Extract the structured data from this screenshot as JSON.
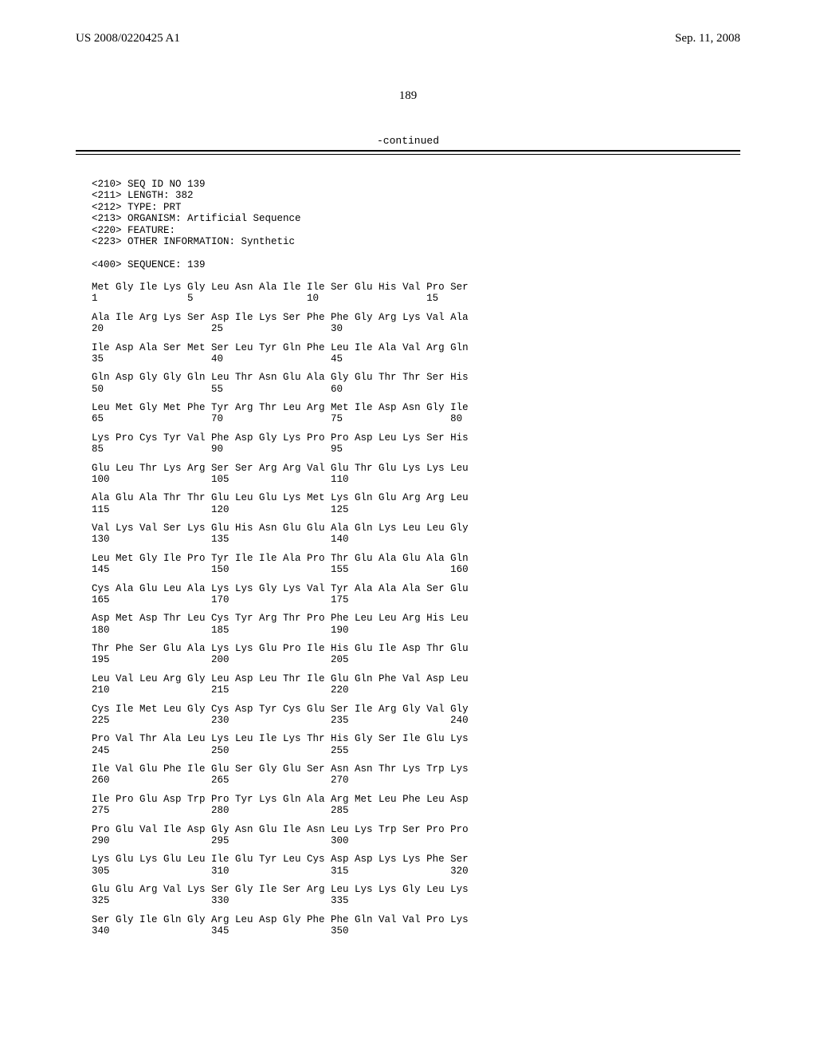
{
  "header": {
    "pub_number": "US 2008/0220425 A1",
    "pub_date": "Sep. 11, 2008"
  },
  "page_number": "189",
  "continued_label": "-continued",
  "meta_lines": [
    "<210> SEQ ID NO 139",
    "<211> LENGTH: 382",
    "<212> TYPE: PRT",
    "<213> ORGANISM: Artificial Sequence",
    "<220> FEATURE:",
    "<223> OTHER INFORMATION: Synthetic",
    "",
    "<400> SEQUENCE: 139"
  ],
  "sequence_rows": [
    {
      "aa": "Met Gly Ile Lys Gly Leu Asn Ala Ile Ile Ser Glu His Val Pro Ser",
      "nums": [
        "1",
        "5",
        "10",
        "15"
      ],
      "pos": [
        0,
        4,
        9,
        14
      ]
    },
    {
      "aa": "Ala Ile Arg Lys Ser Asp Ile Lys Ser Phe Phe Gly Arg Lys Val Ala",
      "nums": [
        "20",
        "25",
        "30"
      ],
      "pos": [
        0,
        5,
        10
      ]
    },
    {
      "aa": "Ile Asp Ala Ser Met Ser Leu Tyr Gln Phe Leu Ile Ala Val Arg Gln",
      "nums": [
        "35",
        "40",
        "45"
      ],
      "pos": [
        0,
        5,
        10
      ]
    },
    {
      "aa": "Gln Asp Gly Gly Gln Leu Thr Asn Glu Ala Gly Glu Thr Thr Ser His",
      "nums": [
        "50",
        "55",
        "60"
      ],
      "pos": [
        0,
        5,
        10
      ]
    },
    {
      "aa": "Leu Met Gly Met Phe Tyr Arg Thr Leu Arg Met Ile Asp Asn Gly Ile",
      "nums": [
        "65",
        "70",
        "75",
        "80"
      ],
      "pos": [
        0,
        5,
        10,
        15
      ]
    },
    {
      "aa": "Lys Pro Cys Tyr Val Phe Asp Gly Lys Pro Pro Asp Leu Lys Ser His",
      "nums": [
        "85",
        "90",
        "95"
      ],
      "pos": [
        0,
        5,
        10
      ]
    },
    {
      "aa": "Glu Leu Thr Lys Arg Ser Ser Arg Arg Val Glu Thr Glu Lys Lys Leu",
      "nums": [
        "100",
        "105",
        "110"
      ],
      "pos": [
        0,
        5,
        10
      ]
    },
    {
      "aa": "Ala Glu Ala Thr Thr Glu Leu Glu Lys Met Lys Gln Glu Arg Arg Leu",
      "nums": [
        "115",
        "120",
        "125"
      ],
      "pos": [
        0,
        5,
        10
      ]
    },
    {
      "aa": "Val Lys Val Ser Lys Glu His Asn Glu Glu Ala Gln Lys Leu Leu Gly",
      "nums": [
        "130",
        "135",
        "140"
      ],
      "pos": [
        0,
        5,
        10
      ]
    },
    {
      "aa": "Leu Met Gly Ile Pro Tyr Ile Ile Ala Pro Thr Glu Ala Glu Ala Gln",
      "nums": [
        "145",
        "150",
        "155",
        "160"
      ],
      "pos": [
        0,
        5,
        10,
        15
      ]
    },
    {
      "aa": "Cys Ala Glu Leu Ala Lys Lys Gly Lys Val Tyr Ala Ala Ala Ser Glu",
      "nums": [
        "165",
        "170",
        "175"
      ],
      "pos": [
        0,
        5,
        10
      ]
    },
    {
      "aa": "Asp Met Asp Thr Leu Cys Tyr Arg Thr Pro Phe Leu Leu Arg His Leu",
      "nums": [
        "180",
        "185",
        "190"
      ],
      "pos": [
        0,
        5,
        10
      ]
    },
    {
      "aa": "Thr Phe Ser Glu Ala Lys Lys Glu Pro Ile His Glu Ile Asp Thr Glu",
      "nums": [
        "195",
        "200",
        "205"
      ],
      "pos": [
        0,
        5,
        10
      ]
    },
    {
      "aa": "Leu Val Leu Arg Gly Leu Asp Leu Thr Ile Glu Gln Phe Val Asp Leu",
      "nums": [
        "210",
        "215",
        "220"
      ],
      "pos": [
        0,
        5,
        10
      ]
    },
    {
      "aa": "Cys Ile Met Leu Gly Cys Asp Tyr Cys Glu Ser Ile Arg Gly Val Gly",
      "nums": [
        "225",
        "230",
        "235",
        "240"
      ],
      "pos": [
        0,
        5,
        10,
        15
      ]
    },
    {
      "aa": "Pro Val Thr Ala Leu Lys Leu Ile Lys Thr His Gly Ser Ile Glu Lys",
      "nums": [
        "245",
        "250",
        "255"
      ],
      "pos": [
        0,
        5,
        10
      ]
    },
    {
      "aa": "Ile Val Glu Phe Ile Glu Ser Gly Glu Ser Asn Asn Thr Lys Trp Lys",
      "nums": [
        "260",
        "265",
        "270"
      ],
      "pos": [
        0,
        5,
        10
      ]
    },
    {
      "aa": "Ile Pro Glu Asp Trp Pro Tyr Lys Gln Ala Arg Met Leu Phe Leu Asp",
      "nums": [
        "275",
        "280",
        "285"
      ],
      "pos": [
        0,
        5,
        10
      ]
    },
    {
      "aa": "Pro Glu Val Ile Asp Gly Asn Glu Ile Asn Leu Lys Trp Ser Pro Pro",
      "nums": [
        "290",
        "295",
        "300"
      ],
      "pos": [
        0,
        5,
        10
      ]
    },
    {
      "aa": "Lys Glu Lys Glu Leu Ile Glu Tyr Leu Cys Asp Asp Lys Lys Phe Ser",
      "nums": [
        "305",
        "310",
        "315",
        "320"
      ],
      "pos": [
        0,
        5,
        10,
        15
      ]
    },
    {
      "aa": "Glu Glu Arg Val Lys Ser Gly Ile Ser Arg Leu Lys Lys Gly Leu Lys",
      "nums": [
        "325",
        "330",
        "335"
      ],
      "pos": [
        0,
        5,
        10
      ]
    },
    {
      "aa": "Ser Gly Ile Gln Gly Arg Leu Asp Gly Phe Phe Gln Val Val Pro Lys",
      "nums": [
        "340",
        "345",
        "350"
      ],
      "pos": [
        0,
        5,
        10
      ]
    }
  ]
}
